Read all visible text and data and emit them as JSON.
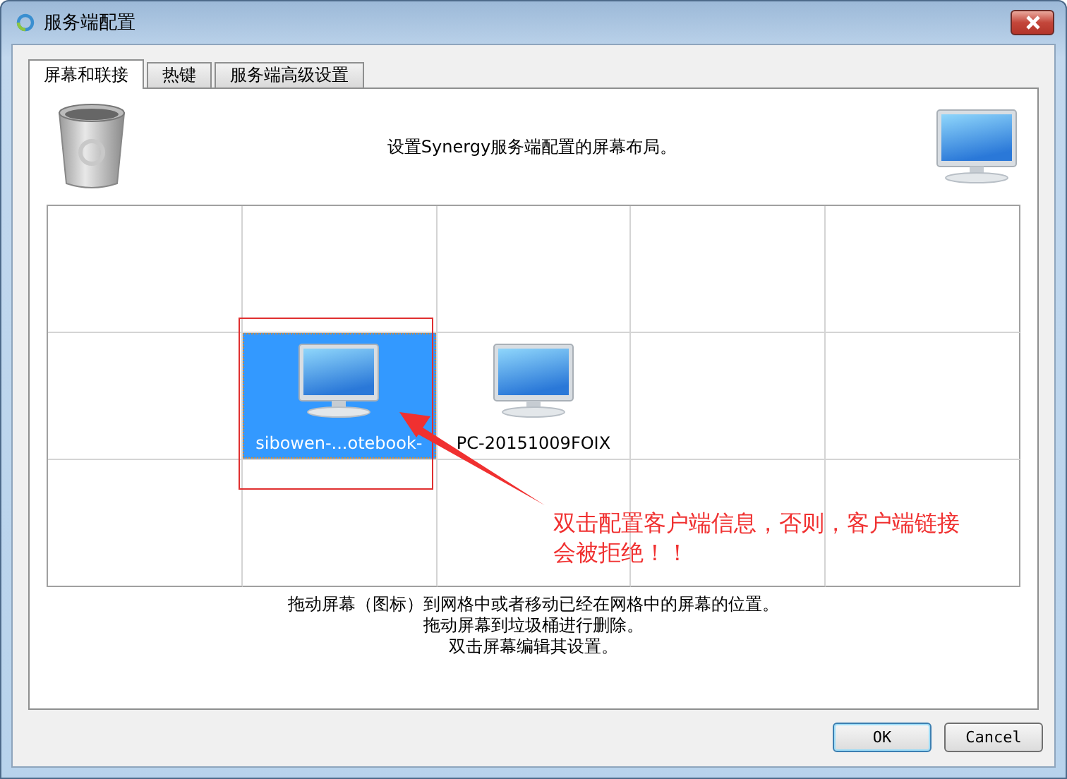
{
  "window": {
    "title": "服务端配置"
  },
  "tabs": [
    {
      "label": "屏幕和联接",
      "selected": true
    },
    {
      "label": "热键",
      "selected": false
    },
    {
      "label": "服务端高级设置",
      "selected": false
    }
  ],
  "layout_heading": "设置Synergy服务端配置的屏幕布局。",
  "grid": {
    "rows": [
      [
        {
          "kind": "empty"
        },
        {
          "kind": "empty"
        },
        {
          "kind": "empty"
        },
        {
          "kind": "empty"
        },
        {
          "kind": "empty"
        }
      ],
      [
        {
          "kind": "empty"
        },
        {
          "kind": "screen",
          "name": "sibowen-...otebook-",
          "selected": true
        },
        {
          "kind": "screen",
          "name": "PC-20151009FOIX",
          "selected": false
        },
        {
          "kind": "empty"
        },
        {
          "kind": "empty"
        }
      ],
      [
        {
          "kind": "empty"
        },
        {
          "kind": "empty"
        },
        {
          "kind": "empty"
        },
        {
          "kind": "empty"
        },
        {
          "kind": "empty"
        }
      ]
    ]
  },
  "annotation": {
    "text": "双击配置客户端信息，否则，客户端链接会被拒绝！！"
  },
  "help_lines": [
    "拖动屏幕（图标）到网格中或者移动已经在网格中的屏幕的位置。",
    "拖动屏幕到垃圾桶进行删除。",
    "双击屏幕编辑其设置。"
  ],
  "buttons": [
    {
      "label": "OK",
      "default": true
    },
    {
      "label": "Cancel",
      "default": false
    }
  ]
}
